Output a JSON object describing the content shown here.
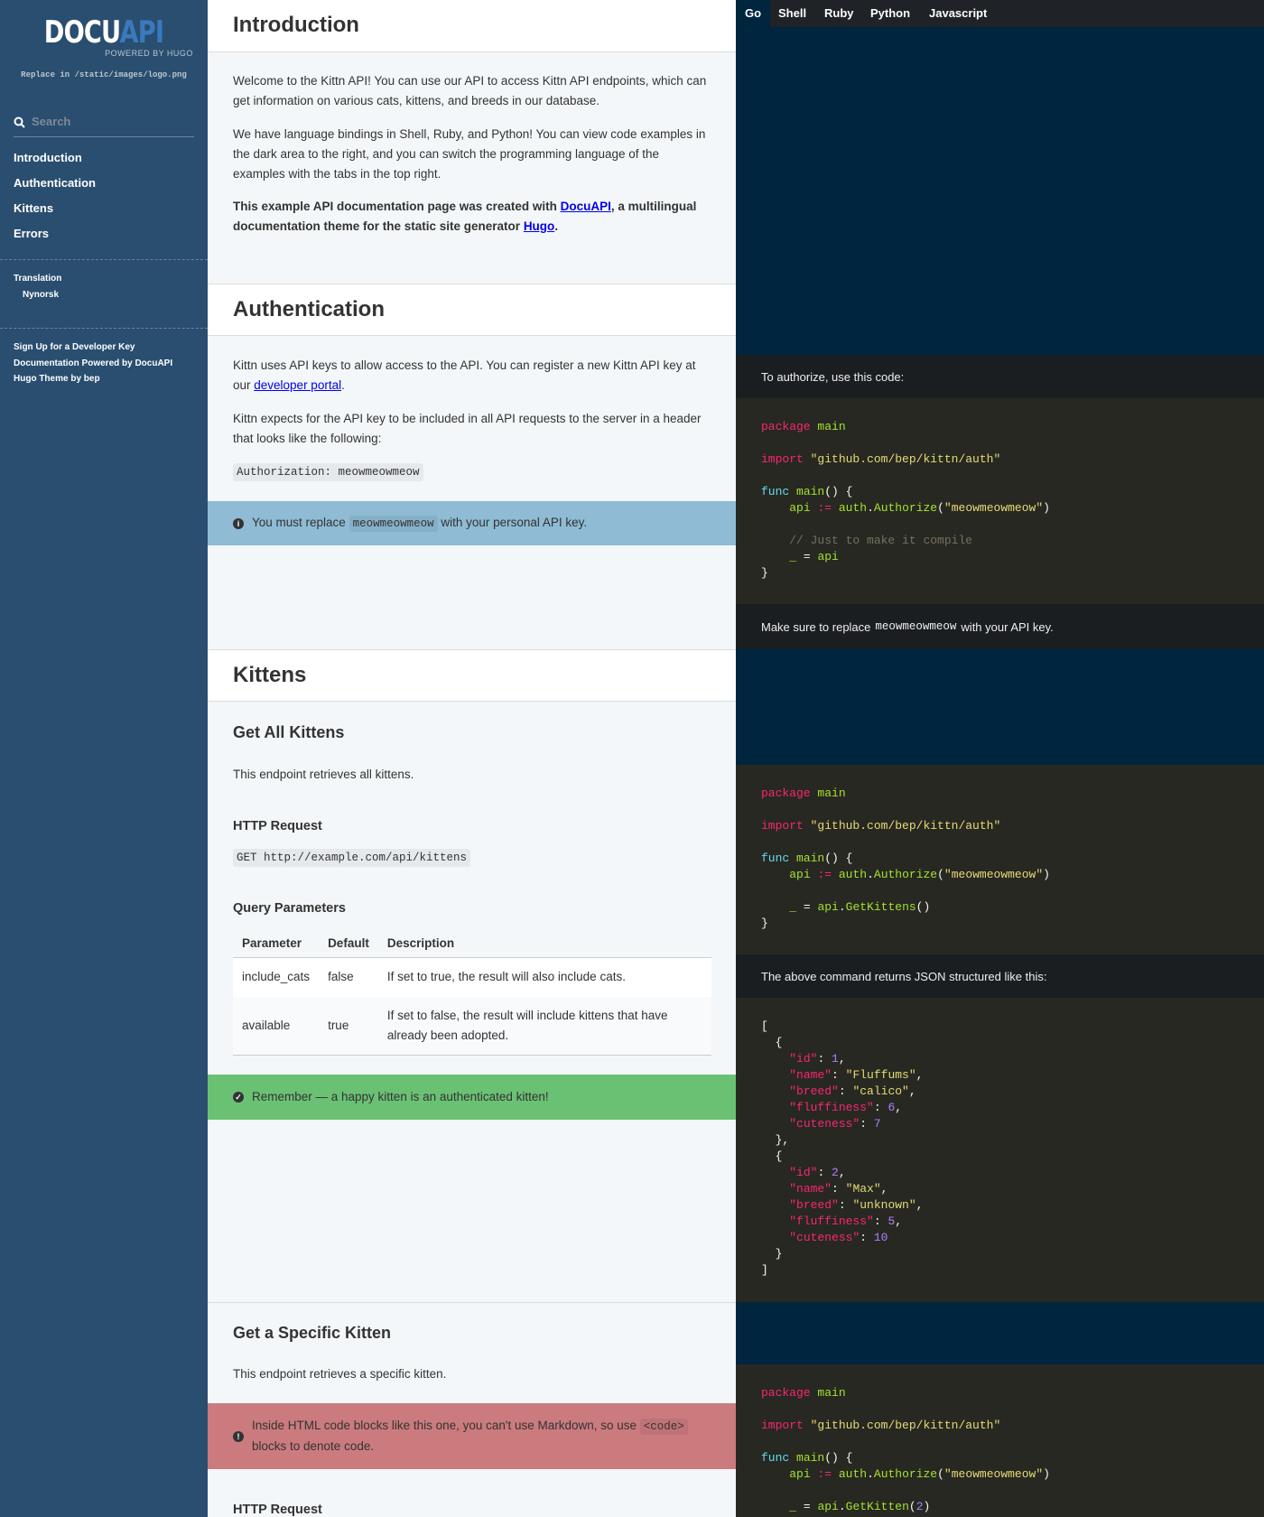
{
  "sidebar": {
    "logo": {
      "part1": "DOCU",
      "part2": "API",
      "sub": "POWERED BY HUGO",
      "note": "Replace in /static/images/logo.png"
    },
    "search_placeholder": "Search",
    "nav": [
      "Introduction",
      "Authentication",
      "Kittens",
      "Errors"
    ],
    "translation_label": "Translation",
    "translation_item": "Nynorsk",
    "links": [
      "Sign Up for a Developer Key",
      "Documentation Powered by DocuAPI",
      "Hugo Theme by bep"
    ]
  },
  "main": {
    "intro": {
      "title": "Introduction",
      "p1": "Welcome to the Kittn API! You can use our API to access Kittn API endpoints, which can get information on various cats, kittens, and breeds in our database.",
      "p2": "We have language bindings in Shell, Ruby, and Python! You can view code examples in the dark area to the right, and you can switch the programming language of the examples with the tabs in the top right.",
      "p3_a": "This example API documentation page was created with ",
      "p3_link1": "DocuAPI",
      "p3_b": ", a multilingual documentation theme for the static site generator ",
      "p3_link2": "Hugo",
      "p3_c": "."
    },
    "auth": {
      "title": "Authentication",
      "p1_a": "Kittn uses API keys to allow access to the API. You can register a new Kittn API key at our ",
      "p1_link": "developer portal",
      "p1_b": ".",
      "p2": "Kittn expects for the API key to be included in all API requests to the server in a header that looks like the following:",
      "code": "Authorization: meowmeowmeow",
      "notice_a": "You must replace ",
      "notice_code": "meowmeowmeow",
      "notice_b": " with your personal API key."
    },
    "kittens": {
      "title": "Kittens",
      "get_all_title": "Get All Kittens",
      "get_all_desc": "This endpoint retrieves all kittens.",
      "http_request": "HTTP Request",
      "http_code": "GET http://example.com/api/kittens",
      "query_params": "Query Parameters",
      "table": {
        "headers": [
          "Parameter",
          "Default",
          "Description"
        ],
        "rows": [
          [
            "include_cats",
            "false",
            "If set to true, the result will also include cats."
          ],
          [
            "available",
            "true",
            "If set to false, the result will include kittens that have already been adopted."
          ]
        ]
      },
      "success_notice": "Remember — a happy kitten is an authenticated kitten!",
      "get_one_title": "Get a Specific Kitten",
      "get_one_desc": "This endpoint retrieves a specific kitten.",
      "warning_a": "Inside HTML code blocks like this one, you can't use Markdown, so use ",
      "warning_code": "<code>",
      "warning_b": " blocks to denote code.",
      "http_request_2": "HTTP Request"
    }
  },
  "right": {
    "tabs": [
      "Go",
      "Shell",
      "Ruby",
      "Python",
      "Javascript"
    ],
    "active_tab": "Go",
    "desc1": "To authorize, use this code:",
    "desc2_a": "Make sure to replace",
    "desc2_code": "meowmeowmeow",
    "desc2_b": "with your API key.",
    "desc3": "The above command returns JSON structured like this:",
    "code_blocks": [
      [
        [
          [
            "k",
            "package"
          ],
          [
            "p",
            " "
          ],
          [
            "n",
            "main"
          ]
        ],
        [],
        [
          [
            "k",
            "import"
          ],
          [
            "p",
            " "
          ],
          [
            "s",
            "\"github.com/bep/kittn/auth\""
          ]
        ],
        [],
        [
          [
            "f",
            "func"
          ],
          [
            "p",
            " "
          ],
          [
            "n",
            "main"
          ],
          [
            "p",
            "() {"
          ]
        ],
        [
          [
            "p",
            "    "
          ],
          [
            "n",
            "api"
          ],
          [
            "p",
            " "
          ],
          [
            "k",
            ":="
          ],
          [
            "p",
            " "
          ],
          [
            "n",
            "auth"
          ],
          [
            "p",
            "."
          ],
          [
            "n",
            "Authorize"
          ],
          [
            "p",
            "("
          ],
          [
            "s",
            "\"meowmeowmeow\""
          ],
          [
            "p",
            ")"
          ]
        ],
        [],
        [
          [
            "p",
            "    "
          ],
          [
            "cm",
            "// Just to make it compile"
          ]
        ],
        [
          [
            "p",
            "    "
          ],
          [
            "n",
            "_"
          ],
          [
            "p",
            " = "
          ],
          [
            "n",
            "api"
          ]
        ],
        [
          [
            "p",
            "}"
          ]
        ]
      ],
      [
        [
          [
            "k",
            "package"
          ],
          [
            "p",
            " "
          ],
          [
            "n",
            "main"
          ]
        ],
        [],
        [
          [
            "k",
            "import"
          ],
          [
            "p",
            " "
          ],
          [
            "s",
            "\"github.com/bep/kittn/auth\""
          ]
        ],
        [],
        [
          [
            "f",
            "func"
          ],
          [
            "p",
            " "
          ],
          [
            "n",
            "main"
          ],
          [
            "p",
            "() {"
          ]
        ],
        [
          [
            "p",
            "    "
          ],
          [
            "n",
            "api"
          ],
          [
            "p",
            " "
          ],
          [
            "k",
            ":="
          ],
          [
            "p",
            " "
          ],
          [
            "n",
            "auth"
          ],
          [
            "p",
            "."
          ],
          [
            "n",
            "Authorize"
          ],
          [
            "p",
            "("
          ],
          [
            "s",
            "\"meowmeowmeow\""
          ],
          [
            "p",
            ")"
          ]
        ],
        [],
        [
          [
            "p",
            "    "
          ],
          [
            "n",
            "_"
          ],
          [
            "p",
            " = "
          ],
          [
            "n",
            "api"
          ],
          [
            "p",
            "."
          ],
          [
            "n",
            "GetKittens"
          ],
          [
            "p",
            "()"
          ]
        ],
        [
          [
            "p",
            "}"
          ]
        ]
      ],
      [
        [
          [
            "p",
            "["
          ]
        ],
        [
          [
            "p",
            "  {"
          ]
        ],
        [
          [
            "p",
            "    "
          ],
          [
            "k",
            "\"id\""
          ],
          [
            "p",
            ": "
          ],
          [
            "m",
            "1"
          ],
          [
            "p",
            ","
          ]
        ],
        [
          [
            "p",
            "    "
          ],
          [
            "k",
            "\"name\""
          ],
          [
            "p",
            ": "
          ],
          [
            "s",
            "\"Fluffums\""
          ],
          [
            "p",
            ","
          ]
        ],
        [
          [
            "p",
            "    "
          ],
          [
            "k",
            "\"breed\""
          ],
          [
            "p",
            ": "
          ],
          [
            "s",
            "\"calico\""
          ],
          [
            "p",
            ","
          ]
        ],
        [
          [
            "p",
            "    "
          ],
          [
            "k",
            "\"fluffiness\""
          ],
          [
            "p",
            ": "
          ],
          [
            "m",
            "6"
          ],
          [
            "p",
            ","
          ]
        ],
        [
          [
            "p",
            "    "
          ],
          [
            "k",
            "\"cuteness\""
          ],
          [
            "p",
            ": "
          ],
          [
            "m",
            "7"
          ]
        ],
        [
          [
            "p",
            "  },"
          ]
        ],
        [
          [
            "p",
            "  {"
          ]
        ],
        [
          [
            "p",
            "    "
          ],
          [
            "k",
            "\"id\""
          ],
          [
            "p",
            ": "
          ],
          [
            "m",
            "2"
          ],
          [
            "p",
            ","
          ]
        ],
        [
          [
            "p",
            "    "
          ],
          [
            "k",
            "\"name\""
          ],
          [
            "p",
            ": "
          ],
          [
            "s",
            "\"Max\""
          ],
          [
            "p",
            ","
          ]
        ],
        [
          [
            "p",
            "    "
          ],
          [
            "k",
            "\"breed\""
          ],
          [
            "p",
            ": "
          ],
          [
            "s",
            "\"unknown\""
          ],
          [
            "p",
            ","
          ]
        ],
        [
          [
            "p",
            "    "
          ],
          [
            "k",
            "\"fluffiness\""
          ],
          [
            "p",
            ": "
          ],
          [
            "m",
            "5"
          ],
          [
            "p",
            ","
          ]
        ],
        [
          [
            "p",
            "    "
          ],
          [
            "k",
            "\"cuteness\""
          ],
          [
            "p",
            ": "
          ],
          [
            "m",
            "10"
          ]
        ],
        [
          [
            "p",
            "  }"
          ]
        ],
        [
          [
            "p",
            "]"
          ]
        ]
      ],
      [
        [
          [
            "k",
            "package"
          ],
          [
            "p",
            " "
          ],
          [
            "n",
            "main"
          ]
        ],
        [],
        [
          [
            "k",
            "import"
          ],
          [
            "p",
            " "
          ],
          [
            "s",
            "\"github.com/bep/kittn/auth\""
          ]
        ],
        [],
        [
          [
            "f",
            "func"
          ],
          [
            "p",
            " "
          ],
          [
            "n",
            "main"
          ],
          [
            "p",
            "() {"
          ]
        ],
        [
          [
            "p",
            "    "
          ],
          [
            "n",
            "api"
          ],
          [
            "p",
            " "
          ],
          [
            "k",
            ":="
          ],
          [
            "p",
            " "
          ],
          [
            "n",
            "auth"
          ],
          [
            "p",
            "."
          ],
          [
            "n",
            "Authorize"
          ],
          [
            "p",
            "("
          ],
          [
            "s",
            "\"meowmeowmeow\""
          ],
          [
            "p",
            ")"
          ]
        ],
        [],
        [
          [
            "p",
            "    "
          ],
          [
            "n",
            "_"
          ],
          [
            "p",
            " = "
          ],
          [
            "n",
            "api"
          ],
          [
            "p",
            "."
          ],
          [
            "n",
            "GetKitten"
          ],
          [
            "p",
            "("
          ],
          [
            "m",
            "2"
          ],
          [
            "p",
            ")"
          ]
        ]
      ]
    ]
  }
}
